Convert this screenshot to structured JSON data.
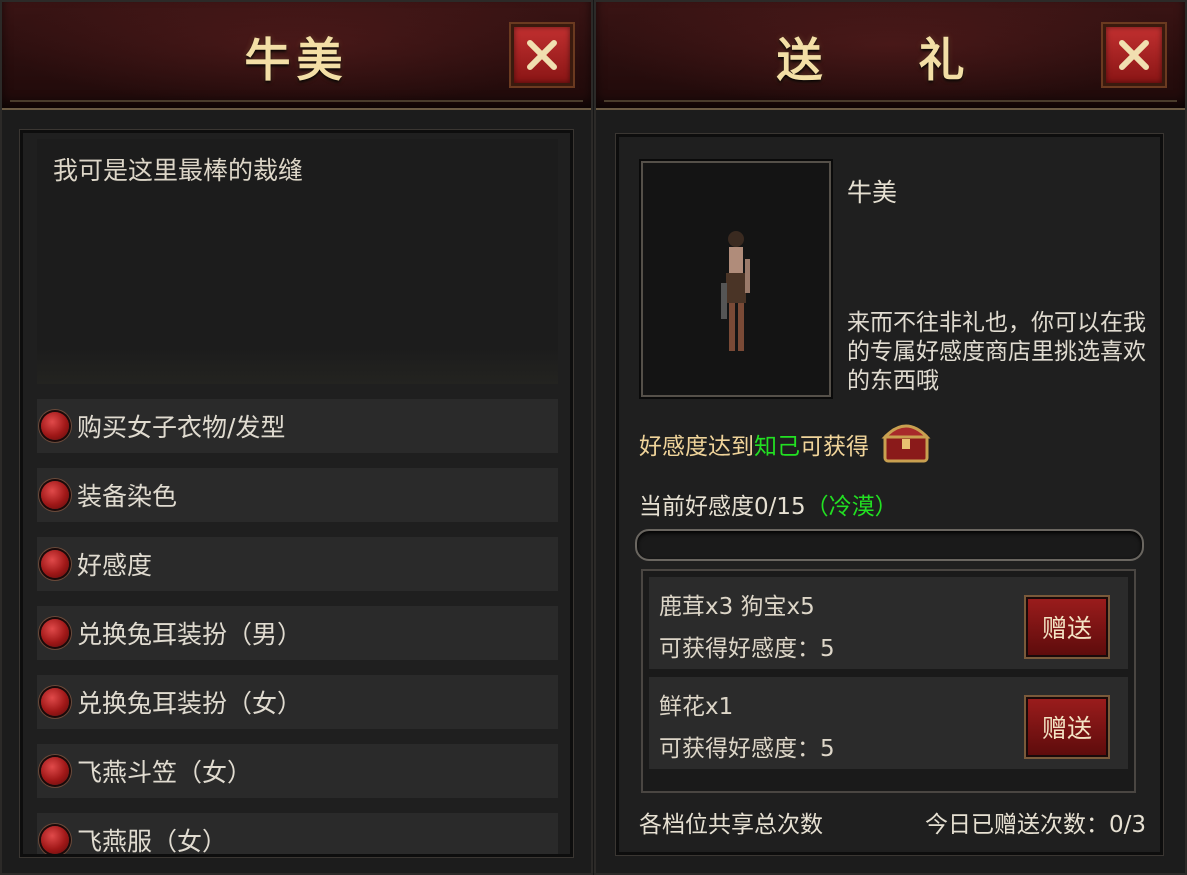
{
  "left": {
    "title": "牛美",
    "speech": "我可是这里最棒的裁缝",
    "menu": [
      "购买女子衣物/发型",
      "装备染色",
      "好感度",
      "兑换兔耳装扮（男）",
      "兑换兔耳装扮（女）",
      "飞燕斗笠（女）",
      "飞燕服（女）"
    ]
  },
  "right": {
    "title": "送  礼",
    "npc_name": "牛美",
    "npc_desc": "来而不往非礼也，你可以在我的专属好感度商店里挑选喜欢的东西哦",
    "favor_prefix": "好感度达到",
    "favor_level": "知己",
    "favor_suffix": "可获得",
    "current_favor_label": "当前好感度0/15",
    "current_favor_state": "（冷漠）",
    "progress_fraction": 0,
    "gifts": [
      {
        "items": "鹿茸x3 狗宝x5",
        "gain": "可获得好感度：5",
        "button": "赠送"
      },
      {
        "items": "鲜花x1",
        "gain": "可获得好感度：5",
        "button": "赠送"
      }
    ],
    "footer_left": "各档位共享总次数",
    "footer_right": "今日已赠送次数：0/3"
  },
  "icons": {
    "close": "close-icon",
    "bullet": "red-orb-bullet-icon",
    "chest": "treasure-chest-icon",
    "portrait": "npc-portrait-figure"
  }
}
